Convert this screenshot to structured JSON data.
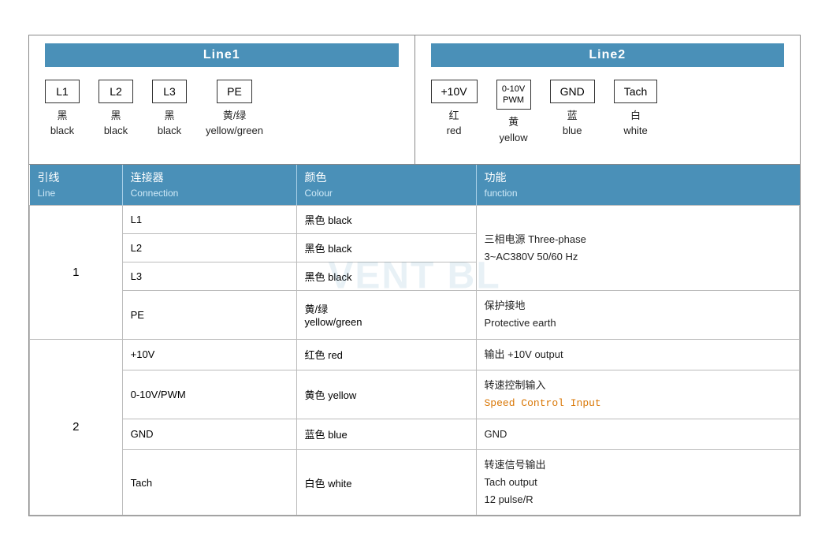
{
  "line1": {
    "header": "Line1",
    "connectors": [
      {
        "label": "L1",
        "zh": "黑",
        "en": "black"
      },
      {
        "label": "L2",
        "zh": "黑",
        "en": "black"
      },
      {
        "label": "L3",
        "zh": "黑",
        "en": "black"
      },
      {
        "label": "PE",
        "zh": "黄/绿",
        "en": "yellow/green"
      }
    ]
  },
  "line2": {
    "header": "Line2",
    "connectors": [
      {
        "label": "+10V",
        "zh": "红",
        "en": "red"
      },
      {
        "label": "0-10V\nPWM",
        "zh": "黄",
        "en": "yellow"
      },
      {
        "label": "GND",
        "zh": "蓝",
        "en": "blue"
      },
      {
        "label": "Tach",
        "zh": "白",
        "en": "white"
      }
    ]
  },
  "table": {
    "headers": [
      {
        "zh": "引线",
        "en": "Line"
      },
      {
        "zh": "连接器",
        "en": "Connection"
      },
      {
        "zh": "颜色",
        "en": "Colour"
      },
      {
        "zh": "功能",
        "en": "function"
      }
    ],
    "rows": [
      {
        "line": "1",
        "rowspan": 4,
        "entries": [
          {
            "connection": "L1",
            "color_zh": "黑色 black",
            "function": "三相电源 Three-phase\n3~AC380V 50/60 Hz",
            "func_rowspan": 3
          },
          {
            "connection": "L2",
            "color_zh": "黑色 black",
            "function": null
          },
          {
            "connection": "L3",
            "color_zh": "黑色 black",
            "function": null
          },
          {
            "connection": "PE",
            "color_zh": "黄/绿\nyellow/green",
            "function": "保护接地\nProtective earth"
          }
        ]
      },
      {
        "line": "2",
        "rowspan": 4,
        "entries": [
          {
            "connection": "+10V",
            "color_zh": "红色 red",
            "function": "输出 +10V output"
          },
          {
            "connection": "0-10V/PWM",
            "color_zh": "黄色 yellow",
            "function": "转速控制输入\nSpeed Control Input"
          },
          {
            "connection": "GND",
            "color_zh": "蓝色 blue",
            "function": "GND"
          },
          {
            "connection": "Tach",
            "color_zh": "白色 white",
            "function": "转速信号输出\nTach output\n12 pulse/R"
          }
        ]
      }
    ]
  },
  "watermark": "VENT BL"
}
